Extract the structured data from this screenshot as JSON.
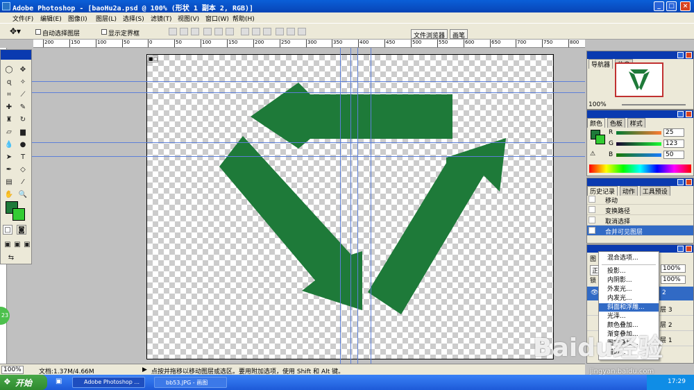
{
  "window": {
    "title": "Adobe Photoshop - [baoHu2a.psd @ 100% (形状 1 副本 2, RGB)]"
  },
  "menu": [
    "文件(F)",
    "编辑(E)",
    "图像(I)",
    "图层(L)",
    "选择(S)",
    "滤镜(T)",
    "视图(V)",
    "窗口(W)",
    "帮助(H)"
  ],
  "options": {
    "auto_select": "自动选择图层",
    "show_bounds": "显示定界框",
    "tab_file_browser": "文件浏览器",
    "tab_brushes": "画笔"
  },
  "ruler_labels": [
    "200",
    "150",
    "100",
    "50",
    "0",
    "50",
    "100",
    "150",
    "200",
    "250",
    "300",
    "350",
    "400",
    "450",
    "500",
    "550",
    "600",
    "650",
    "700",
    "750",
    "800"
  ],
  "canvas": {
    "tab_label": "■□",
    "shape_color": "#1e7a39"
  },
  "status": {
    "zoom": "100%",
    "doc": "文档:1.37M/4.66M",
    "hint": "点按并拖移以移动图层或选区。要用附加选项，使用 Shift 和 Alt 键。"
  },
  "navigator": {
    "tabs": [
      "导航器",
      "信息"
    ],
    "zoom": "100%"
  },
  "color": {
    "tabs": [
      "颜色",
      "色板",
      "样式"
    ],
    "r": "25",
    "g": "123",
    "b": "50",
    "r_label": "R",
    "g_label": "G",
    "b_label": "B"
  },
  "history": {
    "tabs": [
      "历史记录",
      "动作",
      "工具预设"
    ],
    "items": [
      "移动",
      "变换路径",
      "取消选择",
      "合并可见图层"
    ]
  },
  "layers": {
    "tab": "图",
    "mode": "正",
    "opacity": "100%",
    "fill": "100%",
    "lock": "锁",
    "rows": [
      "2",
      "层 3",
      "层 2",
      "层 1"
    ]
  },
  "context_menu": {
    "items": [
      "混合选项...",
      "投影...",
      "内阴影...",
      "外发光...",
      "内发光...",
      "斜面和浮雕...",
      "光泽...",
      "颜色叠加...",
      "渐变叠加...",
      "图案叠加...",
      "描边..."
    ],
    "highlight": 5
  },
  "taskbar": {
    "start": "开始",
    "tasks": [
      "Adobe Photoshop ...",
      "bb53.JPG - 画图"
    ],
    "clock": "17:29"
  },
  "watermark": {
    "logo": "Baidu经验",
    "url": "jingyan.baidu.com"
  },
  "badge": "23"
}
